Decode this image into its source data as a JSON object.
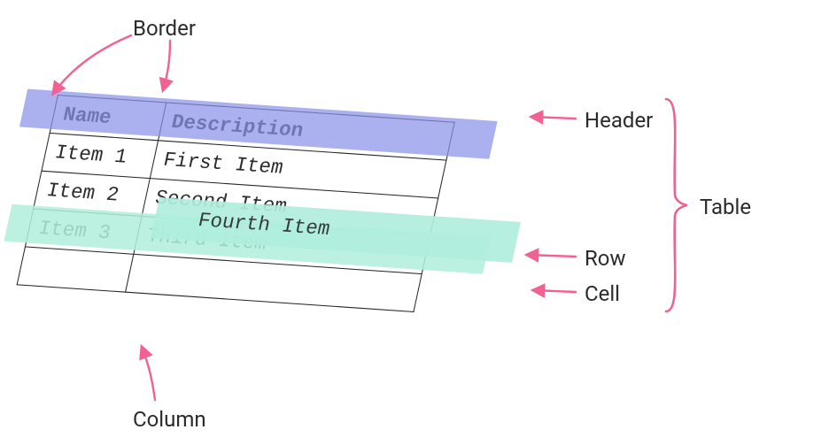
{
  "labels": {
    "border": "Border",
    "header": "Header",
    "row": "Row",
    "cell": "Cell",
    "table": "Table",
    "column": "Column"
  },
  "table": {
    "headers": {
      "name": "Name",
      "description": "Description"
    },
    "rows": [
      {
        "name": "Item 1",
        "description": "First Item"
      },
      {
        "name": "Item 2",
        "description": "Second Item"
      },
      {
        "name": "Item 3",
        "description": "Third Item"
      },
      {
        "name": "",
        "description": ""
      }
    ]
  },
  "floating_cell": "Fourth Item",
  "colors": {
    "pink": "#f06292",
    "header_highlight": "#8a93e8",
    "row_highlight": "#b0eedd"
  }
}
